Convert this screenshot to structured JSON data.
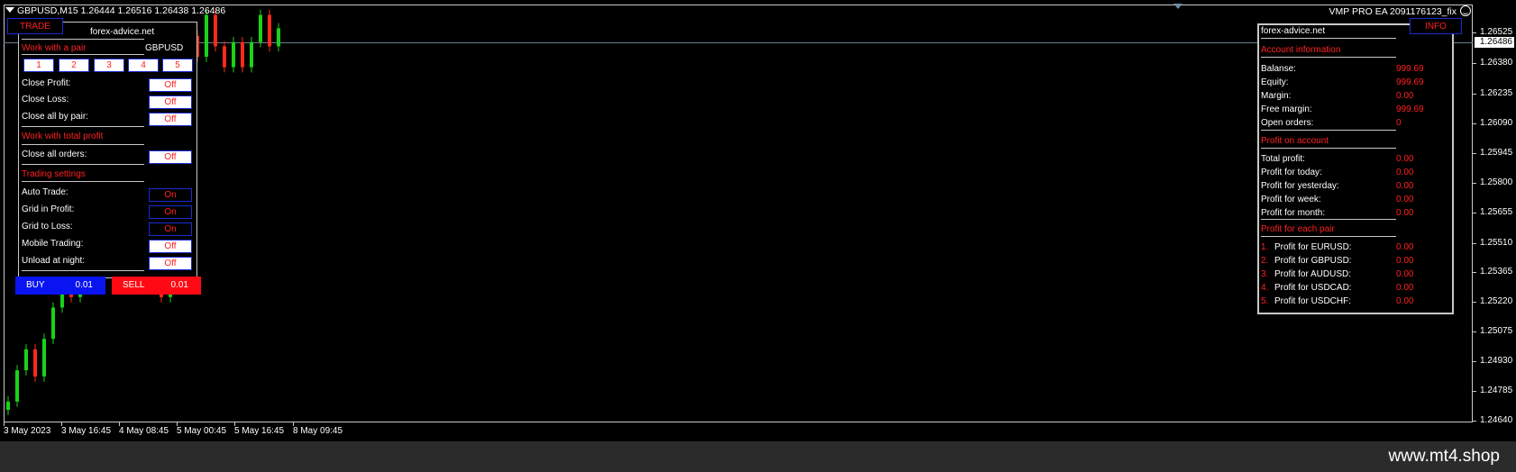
{
  "header": {
    "symbol_line": "GBPUSD,M15  1.26444 1.26516 1.26438 1.26486",
    "ea_title": "VMP PRO EA 2091176123_fix"
  },
  "price_axis": {
    "current_price": "1.26486",
    "ticks": [
      "1.26525",
      "1.26380",
      "1.26235",
      "1.26090",
      "1.25945",
      "1.25800",
      "1.25655",
      "1.25510",
      "1.25365",
      "1.25220",
      "1.25075",
      "1.24930",
      "1.24785",
      "1.24640"
    ]
  },
  "time_axis": {
    "ticks": [
      "3 May 2023",
      "3 May 16:45",
      "4 May 08:45",
      "5 May 00:45",
      "5 May 16:45",
      "8 May 09:45"
    ]
  },
  "candles": {
    "up_color": "#19d219",
    "down_color": "#ff2a1a",
    "closes": [
      1.247,
      1.2485,
      1.2495,
      1.2482,
      1.25,
      1.2515,
      1.253,
      1.252,
      1.2545,
      1.2565,
      1.2555,
      1.2575,
      1.2565,
      1.2595,
      1.2615,
      1.26,
      1.2585,
      1.252,
      1.257,
      1.2625,
      1.2645,
      1.2635,
      1.2655,
      1.264,
      1.263,
      1.2642,
      1.263,
      1.2642,
      1.2655,
      1.264,
      1.26486
    ]
  },
  "trade_panel": {
    "tab_trade": "TRADE",
    "site": "forex-advice.net",
    "work_pair_heading": "Work with a pair",
    "pair_name": "GBPUSD",
    "pair_buttons": [
      "1",
      "2",
      "3",
      "4",
      "5"
    ],
    "close_profit_label": "Close Profit:",
    "close_profit_value": "Off",
    "close_loss_label": "Close Loss:",
    "close_loss_value": "Off",
    "close_all_pair_label": "Close all by pair:",
    "close_all_pair_value": "Off",
    "work_total_heading": "Work with total profit",
    "close_all_orders_label": "Close all orders:",
    "close_all_orders_value": "Off",
    "trading_settings_heading": "Trading settings",
    "auto_trade_label": "Auto Trade:",
    "auto_trade_value": "On",
    "grid_profit_label": "Grid in Profit:",
    "grid_profit_value": "On",
    "grid_loss_label": "Grid to Loss:",
    "grid_loss_value": "On",
    "mobile_trading_label": "Mobile Trading:",
    "mobile_trading_value": "Off",
    "unload_night_label": "Unload at night:",
    "unload_night_value": "Off",
    "buy_label": "BUY",
    "buy_lot": "0.01",
    "sell_label": "SELL",
    "sell_lot": "0.01",
    "buy_color": "#0a14f0",
    "sell_color": "#ff0a14"
  },
  "info_panel": {
    "tab_info": "INFO",
    "site": "forex-advice.net",
    "account_heading": "Account information",
    "balance_label": "Balanse:",
    "balance_value": "999.69",
    "equity_label": "Equity:",
    "equity_value": "999.69",
    "margin_label": "Margin:",
    "margin_value": "0.00",
    "free_margin_label": "Free margin:",
    "free_margin_value": "999.69",
    "open_orders_label": "Open orders:",
    "open_orders_value": "0",
    "profit_account_heading": "Profit on account",
    "total_profit_label": "Total profit:",
    "total_profit_value": "0.00",
    "today_label": "Profit for today:",
    "today_value": "0.00",
    "yesterday_label": "Profit for yesterday:",
    "yesterday_value": "0.00",
    "week_label": "Profit for week:",
    "week_value": "0.00",
    "month_label": "Profit for month:",
    "month_value": "0.00",
    "each_pair_heading": "Profit for each pair",
    "pairs": [
      {
        "num": "1.",
        "label": "Profit for EURUSD:",
        "value": "0.00"
      },
      {
        "num": "2.",
        "label": "Profit for GBPUSD:",
        "value": "0.00"
      },
      {
        "num": "3.",
        "label": "Profit for AUDUSD:",
        "value": "0.00"
      },
      {
        "num": "4.",
        "label": "Profit for USDCAD:",
        "value": "0.00"
      },
      {
        "num": "5.",
        "label": "Profit for USDCHF:",
        "value": "0.00"
      }
    ]
  },
  "footer": {
    "watermark": "www.mt4.shop"
  }
}
